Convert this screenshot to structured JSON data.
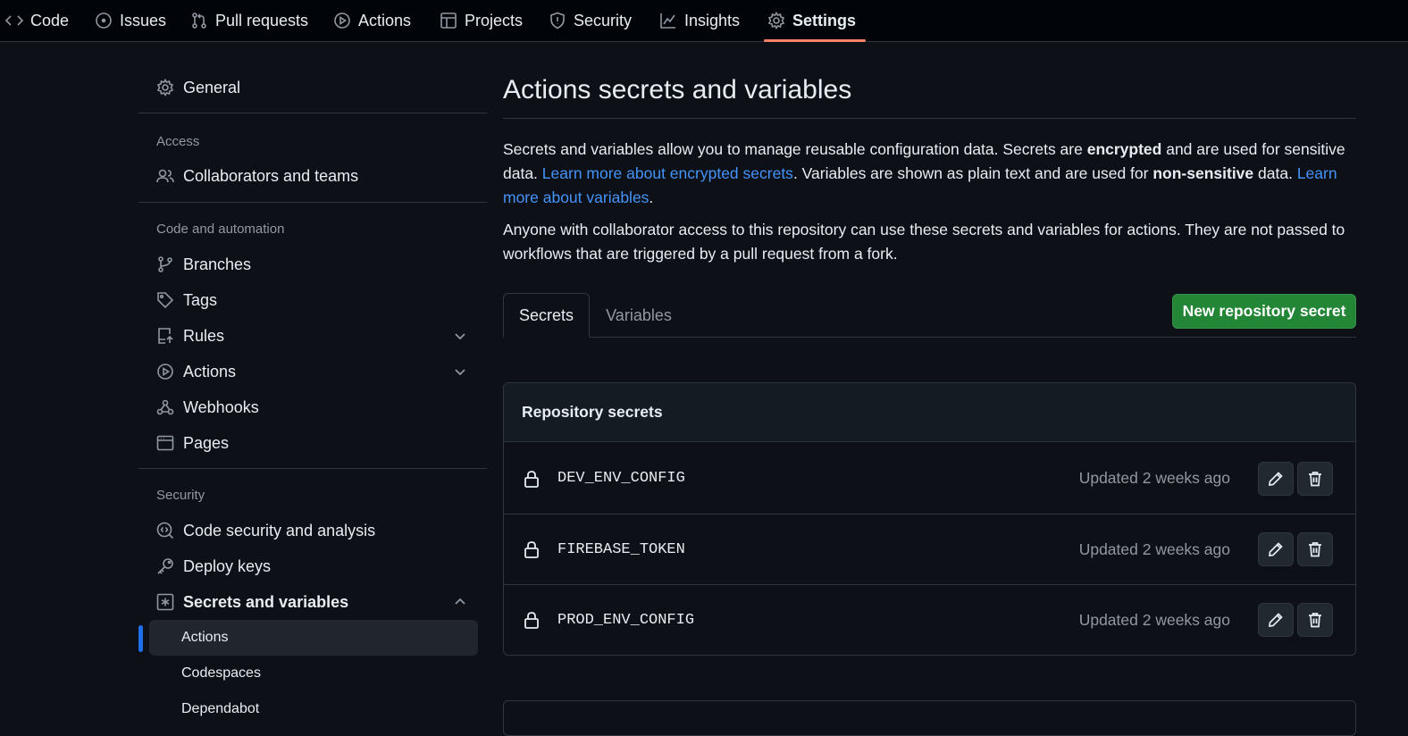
{
  "repo_nav": {
    "tabs": [
      {
        "label": "Code",
        "icon": "code-icon"
      },
      {
        "label": "Issues",
        "icon": "issue-opened-icon"
      },
      {
        "label": "Pull requests",
        "icon": "git-pull-request-icon"
      },
      {
        "label": "Actions",
        "icon": "play-icon"
      },
      {
        "label": "Projects",
        "icon": "table-icon"
      },
      {
        "label": "Security",
        "icon": "shield-icon"
      },
      {
        "label": "Insights",
        "icon": "graph-icon"
      },
      {
        "label": "Settings",
        "icon": "gear-icon",
        "active": true
      }
    ]
  },
  "sidebar": {
    "general": "General",
    "sections": {
      "access": "Access",
      "code_automation": "Code and automation",
      "security": "Security"
    },
    "items": {
      "collaborators": "Collaborators and teams",
      "branches": "Branches",
      "tags": "Tags",
      "rules": "Rules",
      "actions": "Actions",
      "webhooks": "Webhooks",
      "pages": "Pages",
      "code_security": "Code security and analysis",
      "deploy_keys": "Deploy keys",
      "secrets": "Secrets and variables"
    },
    "sub_items": {
      "actions": "Actions",
      "codespaces": "Codespaces",
      "dependabot": "Dependabot"
    }
  },
  "main": {
    "title": "Actions secrets and variables",
    "intro": {
      "p1_a": "Secrets and variables allow you to manage reusable configuration data. Secrets are ",
      "p1_b": "encrypted",
      "p1_c": " and are used for sensitive data. ",
      "p1_link1": "Learn more about encrypted secrets",
      "p1_d": ". Variables are shown as plain text and are used for ",
      "p1_e": "non-sensitive",
      "p1_f": " data. ",
      "p1_link2": "Learn more about variables",
      "p1_g": "."
    },
    "note": "Anyone with collaborator access to this repository can use these secrets and variables for actions. They are not passed to workflows that are triggered by a pull request from a fork.",
    "tabs": {
      "secrets": "Secrets",
      "variables": "Variables"
    },
    "new_secret_button": "New repository secret",
    "repo_secrets": {
      "heading": "Repository secrets",
      "rows": [
        {
          "name": "DEV_ENV_CONFIG",
          "updated": "Updated 2 weeks ago"
        },
        {
          "name": "FIREBASE_TOKEN",
          "updated": "Updated 2 weeks ago"
        },
        {
          "name": "PROD_ENV_CONFIG",
          "updated": "Updated 2 weeks ago"
        }
      ]
    }
  },
  "colors": {
    "background": "#0d1117",
    "accent_underline": "#f78166",
    "link": "#4493f8",
    "primary_button": "#238636",
    "active_indicator": "#1f6feb"
  }
}
